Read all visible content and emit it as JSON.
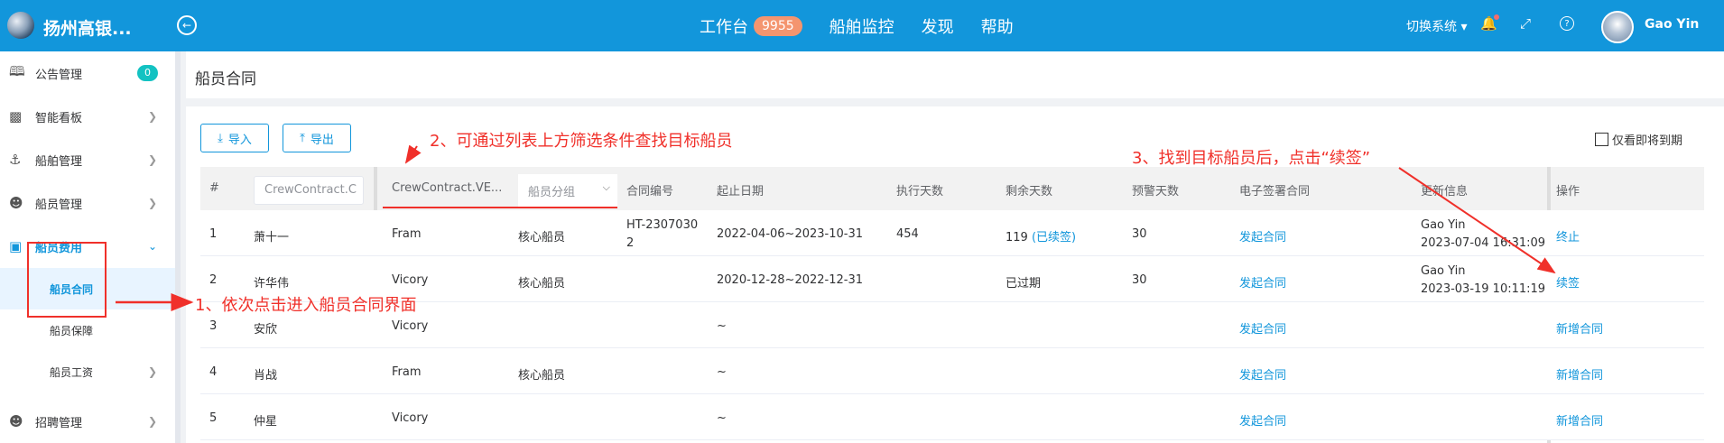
{
  "header": {
    "app_title": "扬州高银...",
    "nav": [
      {
        "label": "工作台",
        "badge": "9955"
      },
      {
        "label": "船舶监控"
      },
      {
        "label": "发现"
      },
      {
        "label": "帮助"
      }
    ],
    "switch_system": "切换系统",
    "username": "Gao Yin"
  },
  "sidebar": {
    "items": [
      {
        "label": "公告管理",
        "icon": "notice-icon",
        "count": "0"
      },
      {
        "label": "智能看板",
        "icon": "chart-icon"
      },
      {
        "label": "船舶管理",
        "icon": "anchor-icon"
      },
      {
        "label": "船员管理",
        "icon": "user-icon"
      },
      {
        "label": "船员费用",
        "icon": "wallet-icon"
      }
    ],
    "subitems": [
      {
        "label": "船员合同"
      },
      {
        "label": "船员保障"
      },
      {
        "label": "船员工资"
      }
    ],
    "last_item": {
      "label": "招聘管理",
      "icon": "recruit-icon"
    }
  },
  "page": {
    "title": "船员合同",
    "import_label": "导入",
    "export_label": "导出",
    "only_expiring_label": "仅看即将到期"
  },
  "table": {
    "headers": {
      "index": "#",
      "name_filter_placeholder": "CrewContract.C",
      "vessel_filter": "CrewContract.VE...",
      "group_filter_placeholder": "船员分组",
      "contract_no": "合同编号",
      "period": "起止日期",
      "exec_days": "执行天数",
      "remaining_days": "剩余天数",
      "warning_days": "预警天数",
      "e_sign": "电子签署合同",
      "update_info": "更新信息",
      "actions": "操作"
    },
    "rows": [
      {
        "idx": "1",
        "name": "萧十一",
        "vessel": "Fram",
        "group": "核心船员",
        "contract_no_1": "HT-2307030",
        "contract_no_2": "2",
        "period": "2022-04-06~2023-10-31",
        "exec_days": "454",
        "remaining": "119",
        "remaining_note": "(已续签)",
        "warning": "30",
        "esign": "发起合同",
        "updater": "Gao Yin",
        "updated_at": "2023-07-04 16:31:09",
        "action": "终止"
      },
      {
        "idx": "2",
        "name": "许华伟",
        "vessel": "Vicory",
        "group": "核心船员",
        "contract_no_1": "",
        "contract_no_2": "",
        "period": "2020-12-28~2022-12-31",
        "exec_days": "",
        "remaining": "已过期",
        "remaining_note": "",
        "warning": "30",
        "esign": "发起合同",
        "updater": "Gao Yin",
        "updated_at": "2023-03-19 10:11:19",
        "action": "续签"
      },
      {
        "idx": "3",
        "name": "安欣",
        "vessel": "Vicory",
        "group": "",
        "contract_no_1": "",
        "contract_no_2": "",
        "period": "~",
        "exec_days": "",
        "remaining": "",
        "remaining_note": "",
        "warning": "",
        "esign": "发起合同",
        "updater": "",
        "updated_at": "",
        "action": "新增合同"
      },
      {
        "idx": "4",
        "name": "肖战",
        "vessel": "Fram",
        "group": "核心船员",
        "contract_no_1": "",
        "contract_no_2": "",
        "period": "~",
        "exec_days": "",
        "remaining": "",
        "remaining_note": "",
        "warning": "",
        "esign": "发起合同",
        "updater": "",
        "updated_at": "",
        "action": "新增合同"
      },
      {
        "idx": "5",
        "name": "仲星",
        "vessel": "Vicory",
        "group": "",
        "contract_no_1": "",
        "contract_no_2": "",
        "period": "~",
        "exec_days": "",
        "remaining": "",
        "remaining_note": "",
        "warning": "",
        "esign": "发起合同",
        "updater": "",
        "updated_at": "",
        "action": "新增合同"
      }
    ]
  },
  "annotations": {
    "step1": "1、依次点击进入船员合同界面",
    "step2": "2、可通过列表上方筛选条件查找目标船员",
    "step3": "3、找到目标船员后，点击“续签”"
  },
  "colors": {
    "primary": "#1296db",
    "badge": "#f4956f",
    "annotation": "#f0302a",
    "count_badge": "#13c2c2"
  }
}
